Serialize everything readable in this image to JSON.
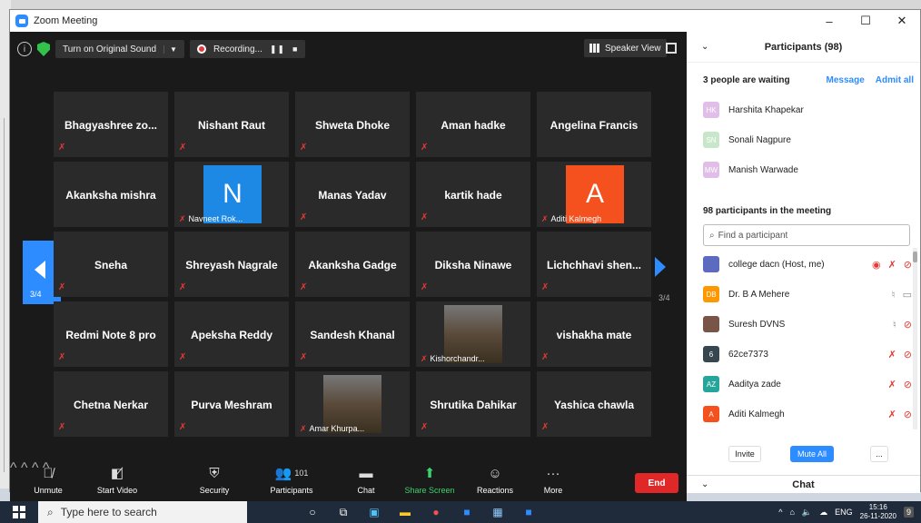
{
  "window": {
    "title": "Zoom Meeting"
  },
  "topbar": {
    "original_sound": "Turn on Original Sound",
    "recording": "Recording...",
    "speaker_view": "Speaker View"
  },
  "page_indicator": "3/4",
  "tiles": [
    {
      "name": "Bhagyashree  zo...",
      "muted": true
    },
    {
      "name": "Nishant Raut",
      "muted": true
    },
    {
      "name": "Shweta Dhoke",
      "muted": true
    },
    {
      "name": "Aman hadke",
      "muted": true
    },
    {
      "name": "Angelina Francis",
      "muted": false
    },
    {
      "name": "Akanksha mishra",
      "muted": false
    },
    {
      "name": "Navneet Rok...",
      "avatar_letter": "N",
      "avatar_color": "#1e88e5",
      "muted": true
    },
    {
      "name": "Manas Yadav",
      "muted": true
    },
    {
      "name": "kartik hade",
      "muted": true
    },
    {
      "name": "Aditi Kalmegh",
      "avatar_letter": "A",
      "avatar_color": "#f4511e",
      "muted": true
    },
    {
      "name": "Sneha",
      "muted": true
    },
    {
      "name": "Shreyash Nagrale",
      "muted": true
    },
    {
      "name": "Akanksha Gadge",
      "muted": true
    },
    {
      "name": "Diksha Ninawe",
      "muted": true
    },
    {
      "name": "Lichchhavi   shen...",
      "muted": true
    },
    {
      "name": "Redmi Note 8 pro",
      "muted": true
    },
    {
      "name": "Apeksha Reddy",
      "muted": true
    },
    {
      "name": "Sandesh Khanal",
      "muted": true
    },
    {
      "name": "Kishorchandr...",
      "muted": true,
      "photo": true
    },
    {
      "name": "vishakha mate",
      "muted": true
    },
    {
      "name": "Chetna Nerkar",
      "muted": true
    },
    {
      "name": "Purva Meshram",
      "muted": true
    },
    {
      "name": "Amar Khurpa...",
      "muted": true,
      "photo": true
    },
    {
      "name": "Shrutika Dahikar",
      "muted": true
    },
    {
      "name": "Yashica chawla",
      "muted": true
    }
  ],
  "toolbar": {
    "unmute": "Unmute",
    "start_video": "Start Video",
    "security": "Security",
    "participants": "Participants",
    "participants_count": "101",
    "chat": "Chat",
    "share_screen": "Share Screen",
    "reactions": "Reactions",
    "more": "More",
    "end": "End"
  },
  "panel": {
    "title": "Participants (98)",
    "waiting_text": "3 people are waiting",
    "message": "Message",
    "admit_all": "Admit all",
    "waiting": [
      {
        "initials": "HK",
        "name": "Harshita Khapekar",
        "color": "#e1bee7"
      },
      {
        "initials": "SN",
        "name": "Sonali Nagpure",
        "color": "#c8e6c9"
      },
      {
        "initials": "MW",
        "name": "Manish Warwade",
        "color": "#e1bee7"
      }
    ],
    "in_meeting": "98 participants in the meeting",
    "search_placeholder": "Find a participant",
    "participants": [
      {
        "initials": "",
        "name": "college dacn (Host, me)",
        "color": "#5c6bc0"
      },
      {
        "initials": "DB",
        "name": "Dr. B A  Mehere",
        "color": "#ff9800"
      },
      {
        "initials": "",
        "name": "Suresh DVNS",
        "color": "#795548"
      },
      {
        "initials": "6",
        "name": "62ce7373",
        "color": "#37474f"
      },
      {
        "initials": "AZ",
        "name": "Aaditya zade",
        "color": "#26a69a"
      },
      {
        "initials": "A",
        "name": "Aditi Kalmegh",
        "color": "#f4511e"
      }
    ],
    "invite": "Invite",
    "mute_all": "Mute All",
    "more": "...",
    "chat": "Chat"
  },
  "taskbar": {
    "search_placeholder": "Type here to search",
    "lang": "ENG",
    "time": "15:16",
    "date": "26-11-2020",
    "notif": "9"
  }
}
